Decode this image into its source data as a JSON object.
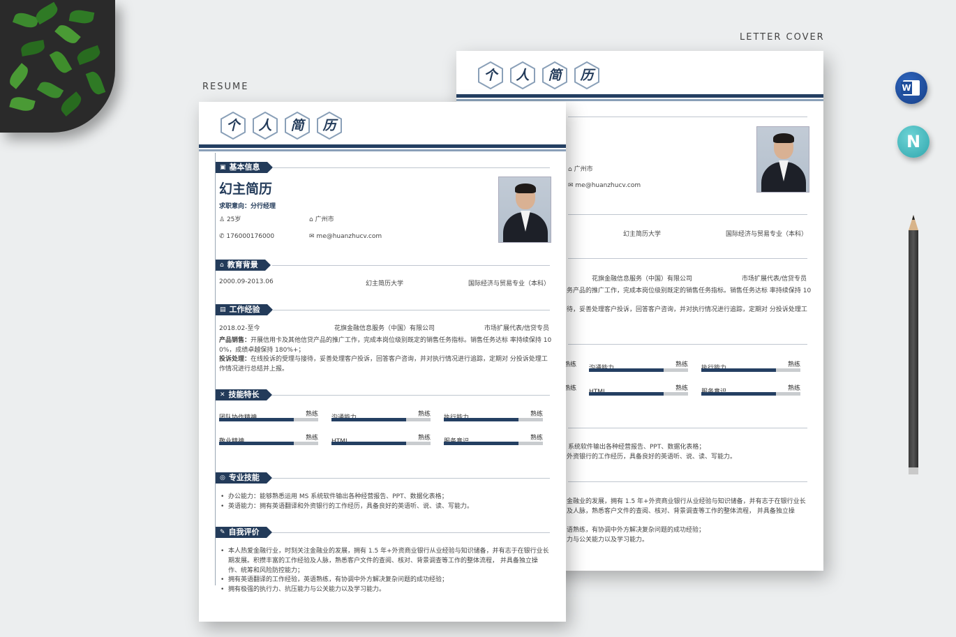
{
  "labels": {
    "resume": "RESUME",
    "letter_cover": "LETTER COVER"
  },
  "title_chars": [
    "个",
    "人",
    "简",
    "历"
  ],
  "icons": {
    "word": "W",
    "app": "N"
  },
  "resume": {
    "sections": {
      "basic": "基本信息",
      "education": "教育背景",
      "work": "工作经验",
      "skills": "技能特长",
      "professional": "专业技能",
      "self_eval": "自我评价"
    },
    "name": "幻主简历",
    "intent": "求职意向：分行经理",
    "age": "25岁",
    "city": "广州市",
    "phone": "176000176000",
    "email": "me@huanzhucv.com",
    "education": {
      "date": "2000.09-2013.06",
      "school": "幻主简历大学",
      "major": "国际经济与贸易专业（本科）"
    },
    "work": {
      "date": "2018.02-至今",
      "company": "花旗金融信息服务（中国）有限公司",
      "position": "市场扩展代表/信贷专员",
      "line1_label": "产品销售：",
      "line1_a": "开展信用卡及其他信贷产品的推广工作，完成本岗位级别既定的销售任务指标。销售任务达标 率持续保持 10",
      "line1_b": "0%，成绩卓越保持 180%+；",
      "line2_label": "投诉处理：",
      "line2_a": "在线投诉的受理与接待，妥善处理客户投诉，回答客户咨询，并对执行情况进行追踪，定期对 分投诉处理工",
      "line2_b": "作情况进行总结并上报。"
    },
    "skills": [
      {
        "name": "团队协作精神",
        "level": "熟练",
        "value": 0.75
      },
      {
        "name": "沟通能力",
        "level": "熟练",
        "value": 0.75
      },
      {
        "name": "执行能力",
        "level": "熟练",
        "value": 0.75
      },
      {
        "name": "敬业精神",
        "level": "熟练",
        "value": 0.75
      },
      {
        "name": "HTML",
        "level": "熟练",
        "value": 0.75
      },
      {
        "name": "服务意识",
        "level": "熟练",
        "value": 0.75
      }
    ],
    "professional": [
      "办公能力：能够熟悉运用 MS 系统软件输出各种经营报告、PPT、数据化表格；",
      "英语能力：拥有英语翻译和外资银行的工作经历，具备良好的英语听、说、读、写能力。"
    ],
    "self_eval": [
      "本人热爱金融行业，时刻关注金融业的发展，拥有 1.5 年+外资商业银行从业经验与知识储备，并有志于在银行业长",
      "期发展。积攒丰富的工作经验及人脉，熟悉客户文件的查阅、核对、背景调查等工作的整体流程， 并具备独立操",
      "作、统筹和风险防控能力；",
      "拥有英语翻译的工作经验，英语熟练，有协调中外方解决复杂问题的成功经验；",
      "拥有极强的执行力、抗压能力与公关能力以及学习能力。"
    ]
  },
  "cover": {
    "city": "广州市",
    "email": "me@huanzhucv.com",
    "school": "幻主简历大学",
    "major": "国际经济与贸易专业（本科）",
    "company": "花旗金融信息服务（中国）有限公司",
    "position": "市场扩展代表/信贷专员",
    "work_line1": "务产品的推广工作，完成本岗位级别既定的销售任务指标。销售任务达标 率持续保持 10",
    "work_line2": "待，妥善处理客户投诉，回答客户咨询，并对执行情况进行追踪，定期对 分投诉处理工",
    "skill_rows": [
      {
        "a_level": "熟练",
        "b_name": "沟通能力",
        "b_level": "熟练",
        "c_name": "执行能力",
        "c_level": "熟练"
      },
      {
        "a_level": "熟练",
        "b_name": "HTML",
        "b_level": "熟练",
        "c_name": "服务意识",
        "c_level": "熟练"
      }
    ],
    "prof_line1": "系统软件输出各种经营报告、PPT、数据化表格；",
    "prof_line2": "外资银行的工作经历，具备良好的英语听、说、读、写能力。",
    "eval_line1": "金融业的发展，拥有 1.5 年+外资商业银行从业经验与知识储备，并有志于在银行业长",
    "eval_line2": "及人脉，熟悉客户文件的查阅、核对、背景调查等工作的整体流程， 并具备独立操",
    "eval_line3": "语熟练，有协调中外方解决复杂问题的成功经验；",
    "eval_line4": "力与公关能力以及学习能力。"
  }
}
